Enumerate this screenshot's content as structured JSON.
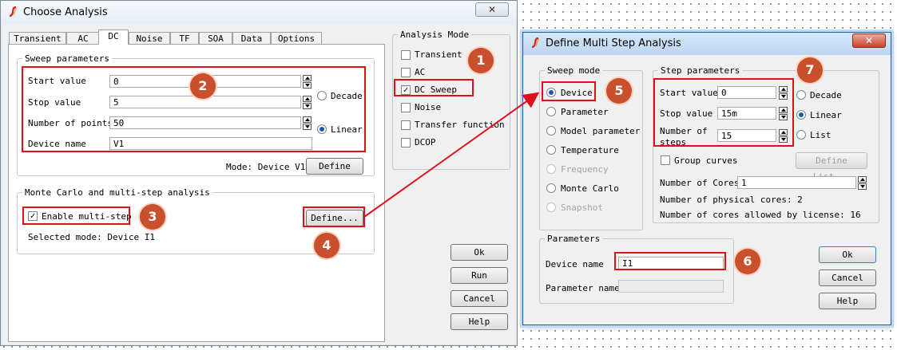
{
  "choose_analysis": {
    "title": "Choose Analysis",
    "close_label": "✕",
    "tabs": [
      "Transient",
      "AC",
      "DC",
      "Noise",
      "TF",
      "SOA",
      "Data",
      "Options"
    ],
    "sweep_parameters": {
      "legend": "Sweep parameters",
      "start_label": "Start value",
      "start_value": "0",
      "stop_label": "Stop value",
      "stop_value": "5",
      "points_label": "Number of points",
      "points_value": "50",
      "device_label": "Device name",
      "device_value": "V1",
      "decade_label": "Decade",
      "linear_label": "Linear",
      "mode_text": "Mode: Device V1",
      "define_label": "Define"
    },
    "monte_carlo": {
      "legend": "Monte Carlo and multi-step analysis",
      "enable_label": "Enable multi-step",
      "define_label": "Define...",
      "selected_mode": "Selected mode: Device I1"
    },
    "analysis_mode": {
      "legend": "Analysis Mode",
      "items": [
        {
          "label": "Transient",
          "checked": false
        },
        {
          "label": "AC",
          "checked": false
        },
        {
          "label": "DC Sweep",
          "checked": true
        },
        {
          "label": "Noise",
          "checked": false
        },
        {
          "label": "Transfer function",
          "checked": false
        },
        {
          "label": "DCOP",
          "checked": false
        }
      ]
    },
    "buttons": {
      "ok": "Ok",
      "run": "Run",
      "cancel": "Cancel",
      "help": "Help"
    }
  },
  "define_multistep": {
    "title": "Define Multi Step Analysis",
    "close_label": "✕",
    "sweep_mode": {
      "legend": "Sweep mode",
      "items": [
        {
          "label": "Device",
          "checked": true,
          "disabled": false
        },
        {
          "label": "Parameter",
          "checked": false,
          "disabled": false
        },
        {
          "label": "Model parameter",
          "checked": false,
          "disabled": false
        },
        {
          "label": "Temperature",
          "checked": false,
          "disabled": false
        },
        {
          "label": "Frequency",
          "checked": false,
          "disabled": true
        },
        {
          "label": "Monte Carlo",
          "checked": false,
          "disabled": false
        },
        {
          "label": "Snapshot",
          "checked": false,
          "disabled": true
        }
      ]
    },
    "step_parameters": {
      "legend": "Step parameters",
      "start_label": "Start value",
      "start_value": "0",
      "stop_label": "Stop value",
      "stop_value": "15m",
      "steps_label_1": "Number of",
      "steps_label_2": "steps",
      "steps_value": "15",
      "decade_label": "Decade",
      "linear_label": "Linear",
      "list_label": "List",
      "group_curves_label": "Group curves",
      "define_list_label": "Define List...",
      "cores_label": "Number of Cores",
      "cores_value": "1",
      "physical_cores": "Number of physical cores: 2",
      "allowed_cores": "Number of cores allowed by license: 16"
    },
    "parameters": {
      "legend": "Parameters",
      "device_label": "Device name",
      "device_value": "I1",
      "param_label": "Parameter name",
      "param_value": ""
    },
    "buttons": {
      "ok": "Ok",
      "cancel": "Cancel",
      "help": "Help"
    }
  },
  "annotations": [
    "1",
    "2",
    "3",
    "4",
    "5",
    "6",
    "7"
  ],
  "colors": {
    "annotation_box": "#e0101a",
    "badge_fill": "#c8502c",
    "arrow": "#e0101a"
  }
}
